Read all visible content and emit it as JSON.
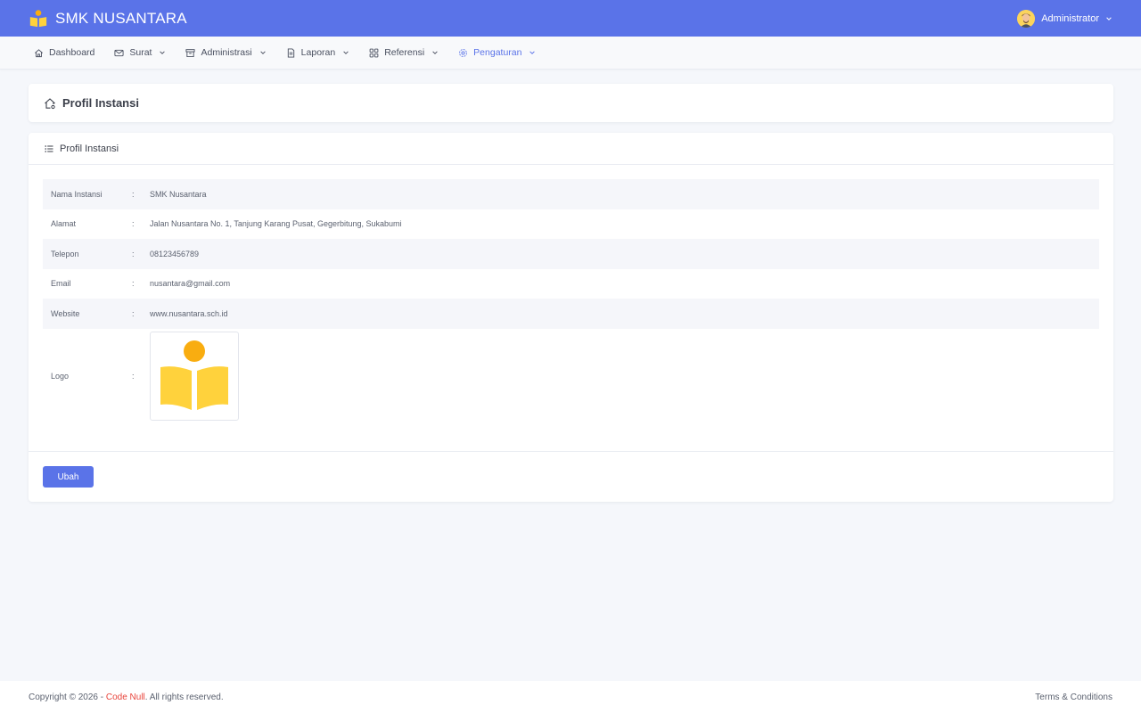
{
  "topbar": {
    "brand_name": "SMK NUSANTARA",
    "brand_logo_icon": "school-book-icon",
    "user_name": "Administrator",
    "background": "#5a73e8"
  },
  "menu": {
    "items": [
      {
        "label": "Dashboard",
        "icon": "home-icon"
      },
      {
        "label": "Surat",
        "icon": "mail-icon"
      },
      {
        "label": "Administrasi",
        "icon": "archive-icon"
      },
      {
        "label": "Laporan",
        "icon": "document-icon"
      },
      {
        "label": "Referensi",
        "icon": "grid-icon"
      },
      {
        "label": "Pengaturan",
        "icon": "gear-icon"
      }
    ]
  },
  "page": {
    "title": "Profil Instansi"
  },
  "profile": {
    "header": "Profil Instansi",
    "colon": ":",
    "fields": [
      {
        "label": "Nama Instansi",
        "value": "SMK Nusantara"
      },
      {
        "label": "Alamat",
        "value": "Jalan Nusantara No. 1, Tanjung Karang Pusat, Gegerbitung, Sukabumi"
      },
      {
        "label": "Telepon",
        "value": "08123456789"
      },
      {
        "label": "Email",
        "value": "nusantara@gmail.com"
      },
      {
        "label": "Website",
        "value": "www.nusantara.sch.id"
      }
    ],
    "logo_label": "Logo",
    "button_label": "Ubah",
    "accent": "#5a73e8"
  },
  "footer": {
    "copyright_prefix": "Copyright © 2026 - ",
    "brand": "Code Null",
    "copyright_suffix": ". All rights reserved.",
    "terms": "Terms & Conditions",
    "brand_color": "#e8443b"
  }
}
